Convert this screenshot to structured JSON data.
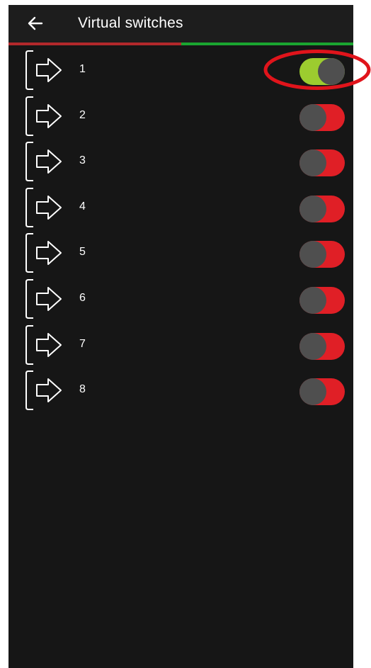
{
  "header": {
    "title": "Virtual switches",
    "back_icon": "arrow-left-icon"
  },
  "colors": {
    "background": "#161616",
    "appbar": "#1d1d1d",
    "tab_left": "#b2282b",
    "tab_right": "#1aa530",
    "toggle_on": "#9ccc2f",
    "toggle_off": "#e01f26",
    "knob": "#4f4f4f",
    "annotation": "#e0141b"
  },
  "switches": [
    {
      "label": "1",
      "state": "on",
      "icon": "output-arrow-icon"
    },
    {
      "label": "2",
      "state": "off",
      "icon": "output-arrow-icon"
    },
    {
      "label": "3",
      "state": "off",
      "icon": "output-arrow-icon"
    },
    {
      "label": "4",
      "state": "off",
      "icon": "output-arrow-icon"
    },
    {
      "label": "5",
      "state": "off",
      "icon": "output-arrow-icon"
    },
    {
      "label": "6",
      "state": "off",
      "icon": "output-arrow-icon"
    },
    {
      "label": "7",
      "state": "off",
      "icon": "output-arrow-icon"
    },
    {
      "label": "8",
      "state": "off",
      "icon": "output-arrow-icon"
    }
  ],
  "annotation": {
    "shape": "ellipse",
    "target": "switch 1 toggle"
  }
}
